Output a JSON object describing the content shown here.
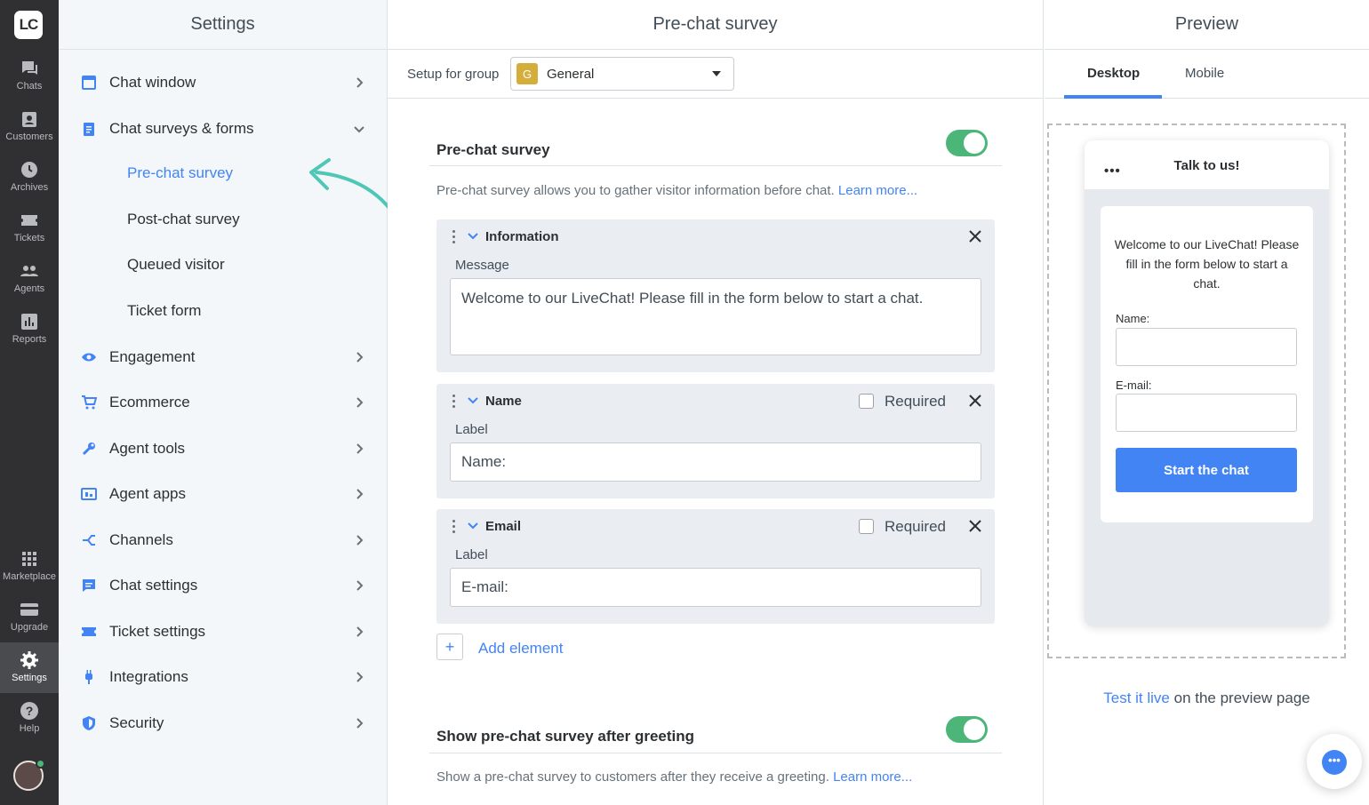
{
  "rail": {
    "logo": "LC",
    "items": [
      {
        "label": "Chats",
        "icon": "chats-icon"
      },
      {
        "label": "Customers",
        "icon": "customers-icon"
      },
      {
        "label": "Archives",
        "icon": "archives-icon"
      },
      {
        "label": "Tickets",
        "icon": "tickets-icon"
      },
      {
        "label": "Agents",
        "icon": "agents-icon"
      },
      {
        "label": "Reports",
        "icon": "reports-icon"
      },
      {
        "label": "Marketplace",
        "icon": "marketplace-icon"
      },
      {
        "label": "Upgrade",
        "icon": "upgrade-icon"
      },
      {
        "label": "Settings",
        "icon": "settings-icon"
      },
      {
        "label": "Help",
        "icon": "help-icon"
      }
    ]
  },
  "settings": {
    "title": "Settings",
    "menu": [
      {
        "label": "Chat window",
        "icon": "chat-window-icon"
      },
      {
        "label": "Chat surveys & forms",
        "icon": "clipboard-icon",
        "expanded": true
      },
      {
        "label": "Engagement",
        "icon": "eye-icon"
      },
      {
        "label": "Ecommerce",
        "icon": "cart-icon"
      },
      {
        "label": "Agent tools",
        "icon": "wrench-icon"
      },
      {
        "label": "Agent apps",
        "icon": "apps-icon"
      },
      {
        "label": "Channels",
        "icon": "channels-icon"
      },
      {
        "label": "Chat settings",
        "icon": "chat-settings-icon"
      },
      {
        "label": "Ticket settings",
        "icon": "ticket-icon"
      },
      {
        "label": "Integrations",
        "icon": "plug-icon"
      },
      {
        "label": "Security",
        "icon": "shield-icon"
      }
    ],
    "submenu": [
      {
        "label": "Pre-chat survey",
        "active": true
      },
      {
        "label": "Post-chat survey"
      },
      {
        "label": "Queued visitor"
      },
      {
        "label": "Ticket form"
      }
    ]
  },
  "main": {
    "title": "Pre-chat survey",
    "group_label": "Setup for group",
    "group_badge": "G",
    "group_name": "General",
    "section1": {
      "title": "Pre-chat survey",
      "desc": "Pre-chat survey allows you to gather visitor information before chat.",
      "link": "Learn more...",
      "enabled": true
    },
    "cards": {
      "information": {
        "title": "Information",
        "label": "Message",
        "value": "Welcome to our LiveChat! Please fill in the form below to start a chat."
      },
      "name": {
        "title": "Name",
        "required_label": "Required",
        "label": "Label",
        "value": "Name:"
      },
      "email": {
        "title": "Email",
        "required_label": "Required",
        "label": "Label",
        "value": "E-mail:"
      }
    },
    "add_symbol": "+",
    "add_label": "Add element",
    "section2": {
      "title": "Show pre-chat survey after greeting",
      "desc": "Show a pre-chat survey to customers after they receive a greeting.",
      "link": "Learn more...",
      "enabled": true
    }
  },
  "preview": {
    "title": "Preview",
    "tabs": [
      "Desktop",
      "Mobile"
    ],
    "widget": {
      "menu": "•••",
      "title": "Talk to us!",
      "message": "Welcome to our LiveChat! Please fill in the form below to start a chat.",
      "name_label": "Name:",
      "email_label": "E-mail:",
      "button": "Start the chat"
    },
    "test_link": "Test it live",
    "test_suffix": " on the preview page",
    "chat_bubble": "•••"
  },
  "colors": {
    "accent": "#4384f5",
    "toggle": "#4bb678",
    "arrow": "#4fc7b7"
  }
}
